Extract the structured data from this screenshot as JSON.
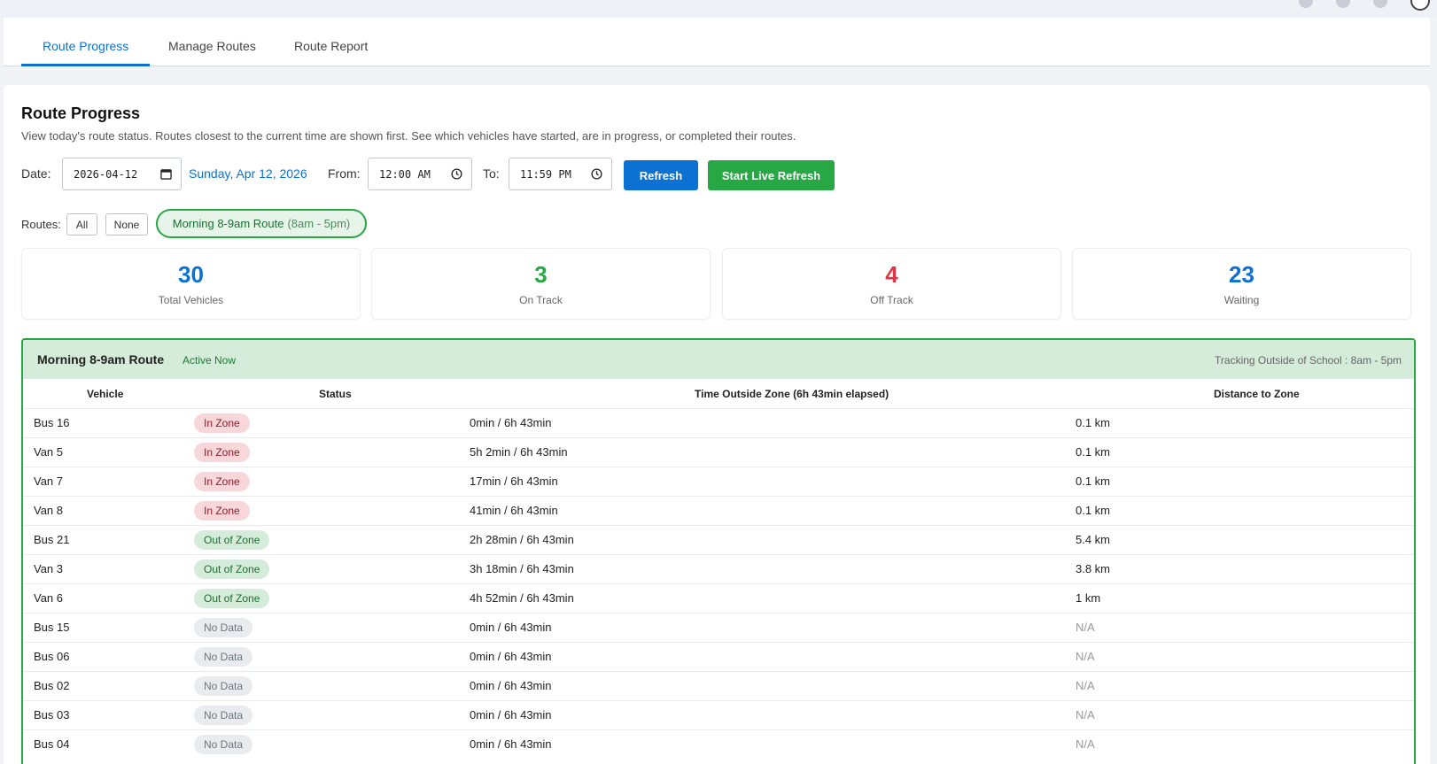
{
  "tabs": [
    {
      "label": "Route Progress"
    },
    {
      "label": "Manage Routes"
    },
    {
      "label": "Route Report"
    }
  ],
  "page": {
    "title": "Route Progress",
    "subtitle": "View today's route status. Routes closest to the current time are shown first. See which vehicles have started, are in progress, or completed their routes."
  },
  "filters": {
    "date_label": "Date:",
    "date_value": "2026-04-12",
    "date_long": "Sunday, Apr 12, 2026",
    "from_label": "From:",
    "from_value": "12:00 AM",
    "to_label": "To:",
    "to_value": "11:59 PM",
    "refresh_label": "Refresh",
    "live_refresh_label": "Start Live Refresh",
    "routes_label": "Routes:",
    "all_label": "All",
    "none_label": "None",
    "route_chip": {
      "name": "Morning 8-9am Route",
      "hours": "(8am - 5pm)"
    }
  },
  "stats": [
    {
      "value": "30",
      "caption": "Total Vehicles",
      "color": "#0b72d4"
    },
    {
      "value": "3",
      "caption": "On Track",
      "color": "#28a745"
    },
    {
      "value": "4",
      "caption": "Off Track",
      "color": "#dc3545"
    },
    {
      "value": "23",
      "caption": "Waiting",
      "color": "#0b72d4"
    }
  ],
  "route": {
    "name": "Morning 8-9am Route",
    "status": "Active Now",
    "tracking": "Tracking Outside of School : 8am - 5pm",
    "columns": {
      "vehicle": "Vehicle",
      "status": "Status",
      "time": "Time Outside Zone (6h 43min elapsed)",
      "distance": "Distance to Zone"
    },
    "rows": [
      {
        "vehicle": "Bus 16",
        "status": "In Zone",
        "kind": "in",
        "time": "0min / 6h 43min",
        "distance": "0.1 km"
      },
      {
        "vehicle": "Van 5",
        "status": "In Zone",
        "kind": "in",
        "time": "5h 2min / 6h 43min",
        "distance": "0.1 km"
      },
      {
        "vehicle": "Van 7",
        "status": "In Zone",
        "kind": "in",
        "time": "17min / 6h 43min",
        "distance": "0.1 km"
      },
      {
        "vehicle": "Van 8",
        "status": "In Zone",
        "kind": "in",
        "time": "41min / 6h 43min",
        "distance": "0.1 km"
      },
      {
        "vehicle": "Bus 21",
        "status": "Out of Zone",
        "kind": "out",
        "time": "2h 28min / 6h 43min",
        "distance": "5.4 km"
      },
      {
        "vehicle": "Van 3",
        "status": "Out of Zone",
        "kind": "out",
        "time": "3h 18min / 6h 43min",
        "distance": "3.8 km"
      },
      {
        "vehicle": "Van 6",
        "status": "Out of Zone",
        "kind": "out",
        "time": "4h 52min / 6h 43min",
        "distance": "1 km"
      },
      {
        "vehicle": "Bus 15",
        "status": "No Data",
        "kind": "nodata",
        "time": "0min / 6h 43min",
        "distance": "N/A"
      },
      {
        "vehicle": "Bus 06",
        "status": "No Data",
        "kind": "nodata",
        "time": "0min / 6h 43min",
        "distance": "N/A"
      },
      {
        "vehicle": "Bus 02",
        "status": "No Data",
        "kind": "nodata",
        "time": "0min / 6h 43min",
        "distance": "N/A"
      },
      {
        "vehicle": "Bus 03",
        "status": "No Data",
        "kind": "nodata",
        "time": "0min / 6h 43min",
        "distance": "N/A"
      },
      {
        "vehicle": "Bus 04",
        "status": "No Data",
        "kind": "nodata",
        "time": "0min / 6h 43min",
        "distance": "N/A"
      }
    ]
  }
}
